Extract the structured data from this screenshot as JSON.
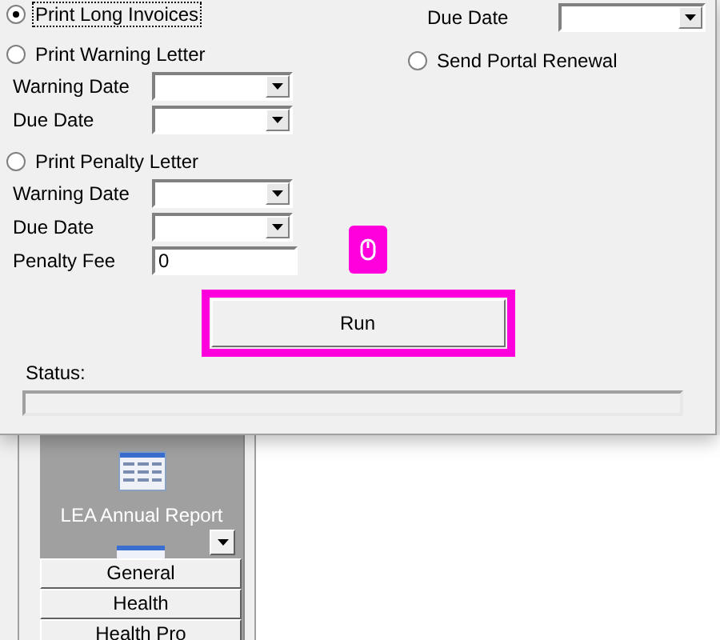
{
  "left": [
    {
      "kind": "radio",
      "label": "Print Long Invoices",
      "selected": true,
      "focused": true
    },
    {
      "kind": "radio",
      "label": "Print Warning Letter",
      "selected": false,
      "focused": false
    },
    {
      "kind": "combo",
      "label": "Warning Date"
    },
    {
      "kind": "combo",
      "label": "Due Date"
    },
    {
      "kind": "radio",
      "label": "Print Penalty Letter",
      "selected": false,
      "focused": false
    },
    {
      "kind": "combo",
      "label": "Warning Date"
    },
    {
      "kind": "combo",
      "label": "Due Date"
    },
    {
      "kind": "text",
      "label": "Penalty Fee",
      "value": "0"
    }
  ],
  "right": [
    {
      "kind": "combo",
      "label": "Due Date"
    },
    {
      "kind": "radio",
      "label": "Send Portal Renewal",
      "selected": false,
      "focused": false
    }
  ],
  "run_button": "Run",
  "status_label": "Status:",
  "sidebar": {
    "report_label": "LEA Annual Report",
    "buttons": [
      "General",
      "Health",
      "Health Pro"
    ]
  }
}
